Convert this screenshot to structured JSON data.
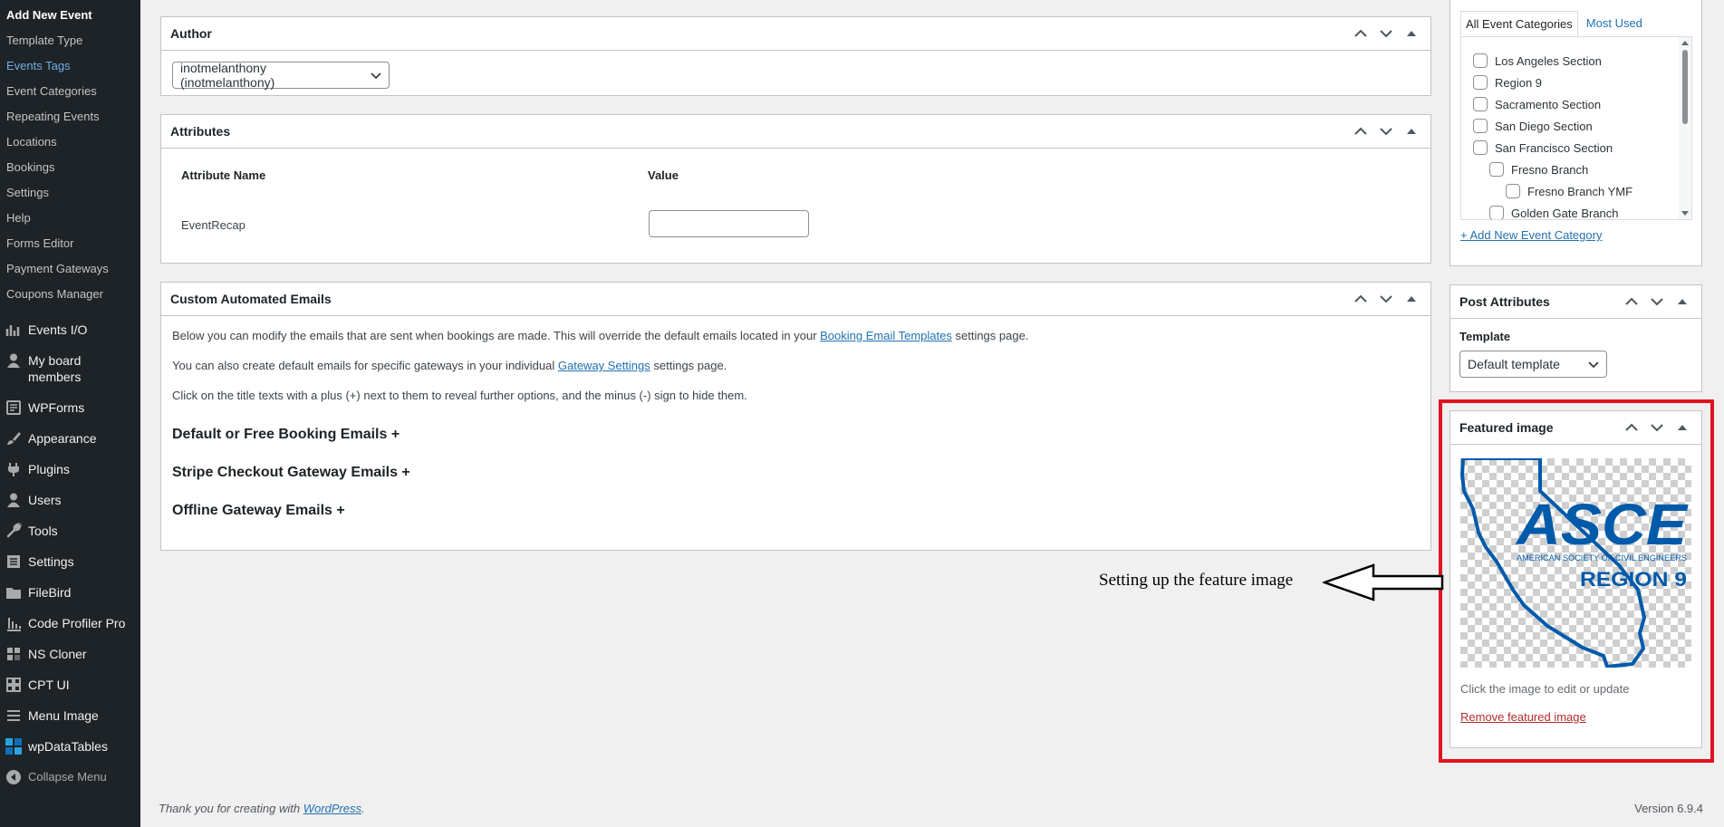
{
  "sidebar": {
    "submenu": [
      {
        "label": "Add New Event",
        "state": "current"
      },
      {
        "label": "Template Type",
        "state": ""
      },
      {
        "label": "Events Tags",
        "state": "active"
      },
      {
        "label": "Event Categories",
        "state": ""
      },
      {
        "label": "Repeating Events",
        "state": ""
      },
      {
        "label": "Locations",
        "state": ""
      },
      {
        "label": "Bookings",
        "state": ""
      },
      {
        "label": "Settings",
        "state": ""
      },
      {
        "label": "Help",
        "state": ""
      },
      {
        "label": "Forms Editor",
        "state": ""
      },
      {
        "label": "Payment Gateways",
        "state": ""
      },
      {
        "label": "Coupons Manager",
        "state": ""
      }
    ],
    "menu": [
      {
        "label": "Events I/O",
        "icon": "chart-bars-icon"
      },
      {
        "label": "My board members",
        "icon": "user-icon"
      },
      {
        "label": "WPForms",
        "icon": "form-icon"
      },
      {
        "label": "Appearance",
        "icon": "paintbrush-icon"
      },
      {
        "label": "Plugins",
        "icon": "plugin-icon"
      },
      {
        "label": "Users",
        "icon": "user-icon"
      },
      {
        "label": "Tools",
        "icon": "wrench-icon"
      },
      {
        "label": "Settings",
        "icon": "settings-grid-icon"
      },
      {
        "label": "FileBird",
        "icon": "folder-icon"
      },
      {
        "label": "Code Profiler Pro",
        "icon": "bar-chart-icon"
      },
      {
        "label": "NS Cloner",
        "icon": "cloner-icon"
      },
      {
        "label": "CPT UI",
        "icon": "grid-icon"
      },
      {
        "label": "Menu Image",
        "icon": "menu-lines-icon"
      },
      {
        "label": "wpDataTables",
        "icon": "datatables-icon"
      }
    ],
    "collapse_label": "Collapse Menu"
  },
  "author_box": {
    "title": "Author",
    "selected": "inotmelanthony (inotmelanthony)"
  },
  "attributes_box": {
    "title": "Attributes",
    "col_name": "Attribute Name",
    "col_value": "Value",
    "rows": [
      {
        "name": "EventRecap",
        "value": ""
      }
    ]
  },
  "emails_box": {
    "title": "Custom Automated Emails",
    "p1_before": "Below you can modify the emails that are sent when bookings are made. This will override the default emails located in your ",
    "p1_link": "Booking Email Templates",
    "p1_after": " settings page.",
    "p2_before": "You can also create default emails for specific gateways in your individual ",
    "p2_link": "Gateway Settings",
    "p2_after": " settings page.",
    "p3": "Click on the title texts with a plus (+) next to them to reveal further options, and the minus (-) sign to hide them.",
    "sections": [
      "Default or Free Booking Emails +",
      "Stripe Checkout Gateway Emails +",
      "Offline Gateway Emails +"
    ]
  },
  "categories_box": {
    "tab_all": "All Event Categories",
    "tab_most_used": "Most Used",
    "items": [
      {
        "label": "Los Angeles Section",
        "level": 0
      },
      {
        "label": "Region 9",
        "level": 0
      },
      {
        "label": "Sacramento Section",
        "level": 0
      },
      {
        "label": "San Diego Section",
        "level": 0
      },
      {
        "label": "San Francisco Section",
        "level": 0
      },
      {
        "label": "Fresno Branch",
        "level": 1
      },
      {
        "label": "Fresno Branch YMF",
        "level": 2
      },
      {
        "label": "Golden Gate Branch",
        "level": 1
      }
    ],
    "add_new": "+ Add New Event Category"
  },
  "post_attributes_box": {
    "title": "Post Attributes",
    "template_label": "Template",
    "template_value": "Default template"
  },
  "featured_image_box": {
    "title": "Featured image",
    "logo_text": "ASCE",
    "logo_subtitle": "AMERICAN SOCIETY OF CIVIL ENGINEERS",
    "logo_region": "REGION 9",
    "hint": "Click the image to edit or update",
    "remove_link": "Remove featured image"
  },
  "annotation": {
    "text": "Setting up the feature image",
    "highlight_color": "#e0141e"
  },
  "footer": {
    "thanks_before": "Thank you for creating with ",
    "thanks_link": "WordPress",
    "thanks_after": ".",
    "version": "Version 6.9.4"
  }
}
